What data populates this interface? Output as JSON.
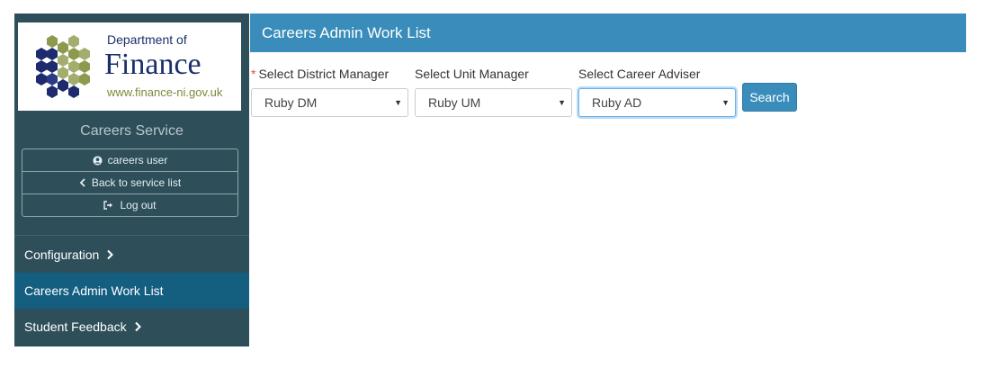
{
  "sidebar": {
    "logo": {
      "department": "Department of",
      "name": "Finance",
      "url": "www.finance-ni.gov.uk"
    },
    "service_name": "Careers Service",
    "user_menu": {
      "username": "careers user",
      "back_label": "Back to service list",
      "logout_label": "Log out"
    },
    "nav": [
      {
        "label": "Configuration",
        "has_chevron": true
      },
      {
        "label": "Careers Admin Work List",
        "active": true
      },
      {
        "label": "Student Feedback",
        "has_chevron": true
      }
    ]
  },
  "header": {
    "title": "Careers Admin Work List"
  },
  "filters": {
    "district_manager": {
      "label": "Select District Manager",
      "required": "*",
      "value": "Ruby DM"
    },
    "unit_manager": {
      "label": "Select Unit Manager",
      "value": "Ruby UM"
    },
    "career_adviser": {
      "label": "Select Career Adviser",
      "value": "Ruby AD"
    }
  },
  "search_button": {
    "label": "Search"
  },
  "colors": {
    "sidebar_bg": "#2e4f5a",
    "active_nav_bg": "#145e80",
    "header_bg": "#3a8dba",
    "button_bg": "#3a8dba",
    "logo_navy": "#1a2f6b",
    "logo_olive": "#7a8a3a"
  }
}
